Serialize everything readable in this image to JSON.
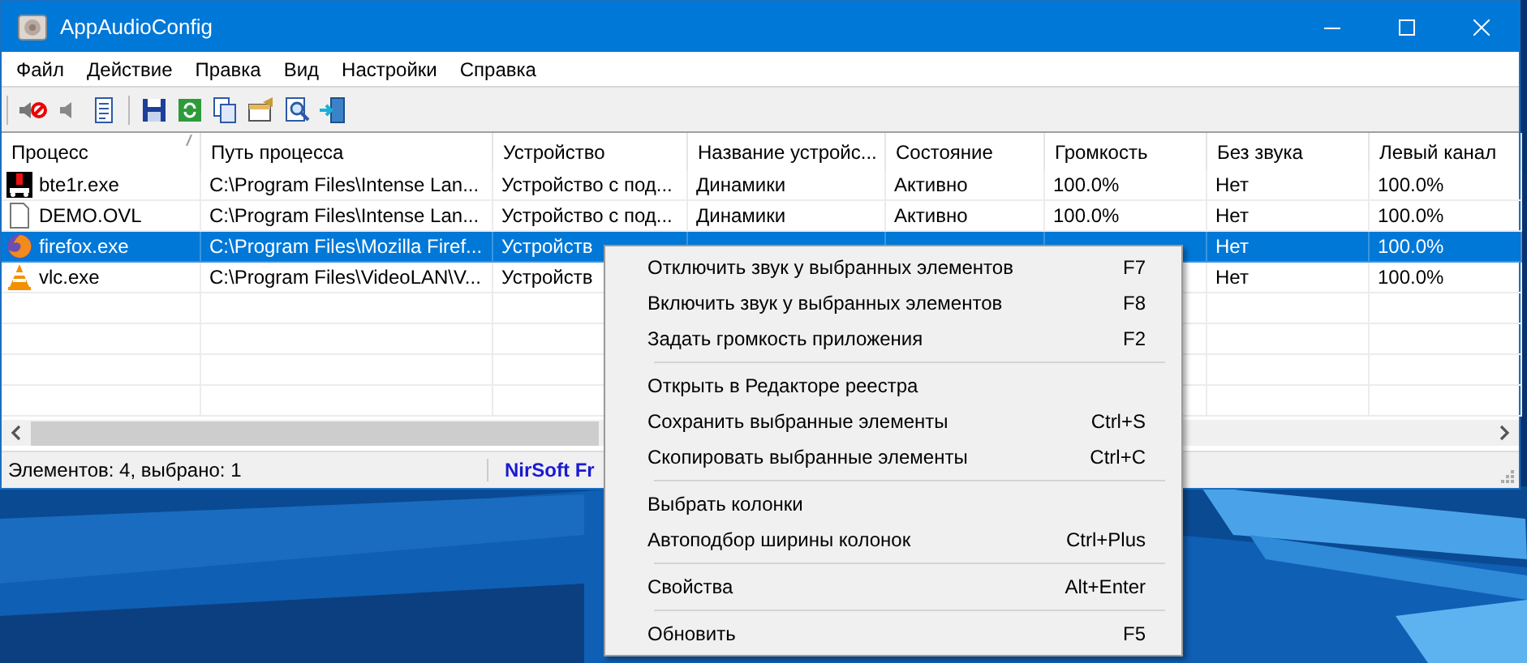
{
  "window": {
    "title": "AppAudioConfig"
  },
  "menu_bar": [
    "Файл",
    "Действие",
    "Правка",
    "Вид",
    "Настройки",
    "Справка"
  ],
  "table": {
    "columns": [
      {
        "label": "Процесс",
        "sorted": true
      },
      {
        "label": "Путь процесса",
        "sorted": false
      },
      {
        "label": "Устройство",
        "sorted": false
      },
      {
        "label": "Название устройс...",
        "sorted": false
      },
      {
        "label": "Состояние",
        "sorted": false
      },
      {
        "label": "Громкость",
        "sorted": false
      },
      {
        "label": "Без звука",
        "sorted": false
      },
      {
        "label": "Левый канал",
        "sorted": false
      }
    ],
    "rows": [
      {
        "selected": false,
        "cells": [
          "bte1r.exe",
          "C:\\Program Files\\Intense Lan...",
          "Устройство с под...",
          "Динамики",
          "Активно",
          "100.0%",
          "Нет",
          "100.0%"
        ]
      },
      {
        "selected": false,
        "cells": [
          "DEMO.OVL",
          "C:\\Program Files\\Intense Lan...",
          "Устройство с под...",
          "Динамики",
          "Активно",
          "100.0%",
          "Нет",
          "100.0%"
        ]
      },
      {
        "selected": true,
        "cells": [
          "firefox.exe",
          "C:\\Program Files\\Mozilla Firef...",
          "Устройств",
          null,
          null,
          null,
          "Нет",
          "100.0%"
        ]
      },
      {
        "selected": false,
        "cells": [
          "vlc.exe",
          "C:\\Program Files\\VideoLAN\\V...",
          "Устройств",
          null,
          null,
          null,
          "Нет",
          "100.0%"
        ]
      }
    ]
  },
  "status_bar": {
    "count": "Элементов: 4, выбрано: 1",
    "link": "NirSoft Fr"
  },
  "context_menu": [
    {
      "kind": "item",
      "label": "Отключить звук у выбранных элементов",
      "shortcut": "F7"
    },
    {
      "kind": "item",
      "label": "Включить звук у выбранных элементов",
      "shortcut": "F8"
    },
    {
      "kind": "item",
      "label": "Задать громкость приложения",
      "shortcut": "F2"
    },
    {
      "kind": "separator"
    },
    {
      "kind": "item",
      "label": "Открыть в Редакторе реестра"
    },
    {
      "kind": "item",
      "label": "Сохранить выбранные элементы",
      "shortcut": "Ctrl+S"
    },
    {
      "kind": "item",
      "label": "Скопировать выбранные элементы",
      "shortcut": "Ctrl+C"
    },
    {
      "kind": "separator"
    },
    {
      "kind": "item",
      "label": "Выбрать колонки"
    },
    {
      "kind": "item",
      "label": "Автоподбор ширины колонок",
      "shortcut": "Ctrl+Plus"
    },
    {
      "kind": "separator"
    },
    {
      "kind": "item",
      "label": "Свойства",
      "shortcut": "Alt+Enter"
    },
    {
      "kind": "separator"
    },
    {
      "kind": "item",
      "label": "Обновить",
      "shortcut": "F5"
    }
  ]
}
